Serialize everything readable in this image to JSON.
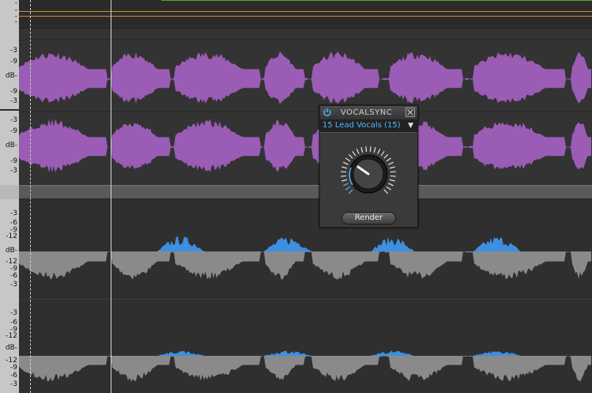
{
  "rulers": {
    "top_ticks": [
      "-",
      "-",
      "-",
      "-"
    ],
    "lane1_ticks": [
      "-3",
      "-9",
      "dB-",
      "-9",
      "-3"
    ],
    "lane2_ticks": [
      "-3",
      "-9",
      "dB-",
      "-9",
      "-3"
    ],
    "lane3_ticks": [
      "-3",
      "-6",
      "-9",
      "-12",
      "dB-",
      "-12",
      "-9",
      "-6",
      "-3"
    ],
    "lane4_ticks": [
      "-3",
      "-6",
      "-9",
      "-12",
      "dB-",
      "-12",
      "-9",
      "-6",
      "-3"
    ]
  },
  "plugin": {
    "title": "VOCALSYNC",
    "selected_track": "15 Lead Vocals (15)",
    "dropdown_arrow": "▼",
    "render_label": "Render",
    "power_icon": "power-icon",
    "close_icon": "close-icon"
  },
  "colors": {
    "guide_waveform": "#9a5cb4",
    "aligned_positive": "#3f8fe0",
    "aligned_negative": "#8a8a8a",
    "automation_orange": "#d9892b",
    "automation_green": "#5aa03a",
    "accent_blue": "#4fb7ff"
  }
}
